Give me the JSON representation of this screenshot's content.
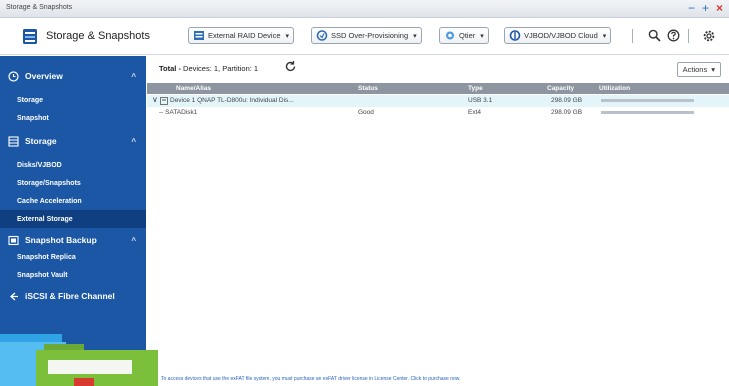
{
  "window": {
    "title": "Storage & Snapshots"
  },
  "header": {
    "app_title": "Storage & Snapshots",
    "toolbar": [
      {
        "label": "External RAID Device",
        "icon": "raid-device-icon"
      },
      {
        "label": "SSD Over-Provisioning",
        "icon": "ssd-icon"
      },
      {
        "label": "Qtier",
        "icon": "qtier-icon"
      },
      {
        "label": "VJBOD/VJBOD Cloud",
        "icon": "vjbod-icon"
      }
    ]
  },
  "sidebar": {
    "sections": [
      {
        "label": "Overview",
        "icon": "overview-icon",
        "items": [
          "Storage",
          "Snapshot"
        ]
      },
      {
        "label": "Storage",
        "icon": "storage-icon",
        "items": [
          "Disks/VJBOD",
          "Storage/Snapshots",
          "Cache Acceleration",
          "External Storage"
        ]
      },
      {
        "label": "Snapshot Backup",
        "icon": "snapshot-backup-icon",
        "items": [
          "Snapshot Replica",
          "Snapshot Vault"
        ]
      },
      {
        "label": "iSCSI & Fibre Channel",
        "icon": "iscsi-icon",
        "items": []
      }
    ],
    "active_item": "External Storage"
  },
  "main": {
    "total_label": "Total -",
    "total_text": "Devices: 1, Partition: 1",
    "actions_label": "Actions",
    "columns": [
      "Name/Alias",
      "Status",
      "Type",
      "Capacity",
      "Utilization"
    ],
    "rows": [
      {
        "name": "Device 1 QNAP TL-D800u: Individual Dis...",
        "status": "",
        "type": "USB 3.1",
        "capacity": "298.09 GB",
        "utilization": 0
      },
      {
        "name": "-- SATADisk1",
        "status": "Good",
        "type": "Ext4",
        "capacity": "298.09 GB",
        "utilization": 0
      }
    ],
    "footer_note": "To access devices that use the exFAT file system, you must purchase an exFAT driver license in License Center. Click to purchase now."
  },
  "colors": {
    "sidebar": "#1c57a5",
    "sidebar_active": "#0f3f80",
    "table_header": "#8d95a0",
    "selected_row": "#e4f5fa",
    "link": "#2a63c3",
    "close": "#e0382a"
  }
}
